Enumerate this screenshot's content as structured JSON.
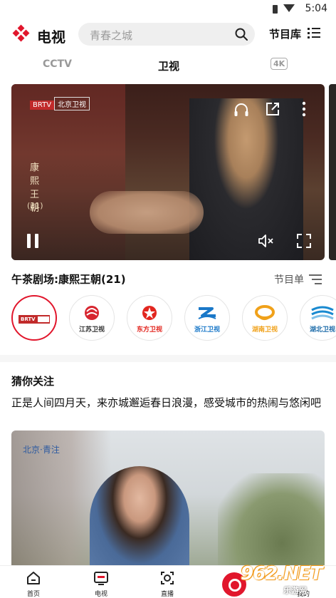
{
  "status_bar": {
    "time": "5:04"
  },
  "header": {
    "title": "电视",
    "search_placeholder": "青春之城",
    "guide_label": "节目库"
  },
  "tabs": [
    {
      "label": "CCTV",
      "active": false
    },
    {
      "label": "卫视",
      "active": true
    },
    {
      "label": "4K",
      "active": false
    }
  ],
  "player": {
    "watermark_logo": "BRTV",
    "watermark_channel": "北京卫视",
    "vertical_title": "康熙王朝",
    "episode": "(21)"
  },
  "now_playing": {
    "title": "午茶剧场:康熙王朝(21)",
    "schedule_label": "节目单"
  },
  "channels": [
    {
      "name": "BRTV北京卫视",
      "color": "#c12a2a",
      "active": true
    },
    {
      "name": "江苏卫视",
      "color": "#d7252f",
      "active": false
    },
    {
      "name": "东方卫视",
      "color": "#e2261f",
      "active": false
    },
    {
      "name": "浙江卫视",
      "color": "#1a78c8",
      "active": false
    },
    {
      "name": "湖南卫视",
      "color": "#f0a11a",
      "active": false
    },
    {
      "name": "湖北卫视",
      "color": "#1a8ad0",
      "active": false
    }
  ],
  "recommend": {
    "heading": "猜你关注",
    "description": "正是人间四月天，来亦城邂逅春日浪漫，感受城市的热闹与悠闲吧",
    "image_caption": "北京·青注"
  },
  "bottom_nav": [
    {
      "label": "首页",
      "icon": "home-icon",
      "active": false
    },
    {
      "label": "电视",
      "icon": "tv-icon",
      "active": true
    },
    {
      "label": "直播",
      "icon": "live-icon",
      "active": false
    },
    {
      "label": "我的",
      "icon": "profile-icon",
      "active": false
    }
  ],
  "site_watermark": {
    "big": "962.NET",
    "small": "乐游网"
  },
  "colors": {
    "accent": "#e1162c",
    "muted": "#999999"
  }
}
